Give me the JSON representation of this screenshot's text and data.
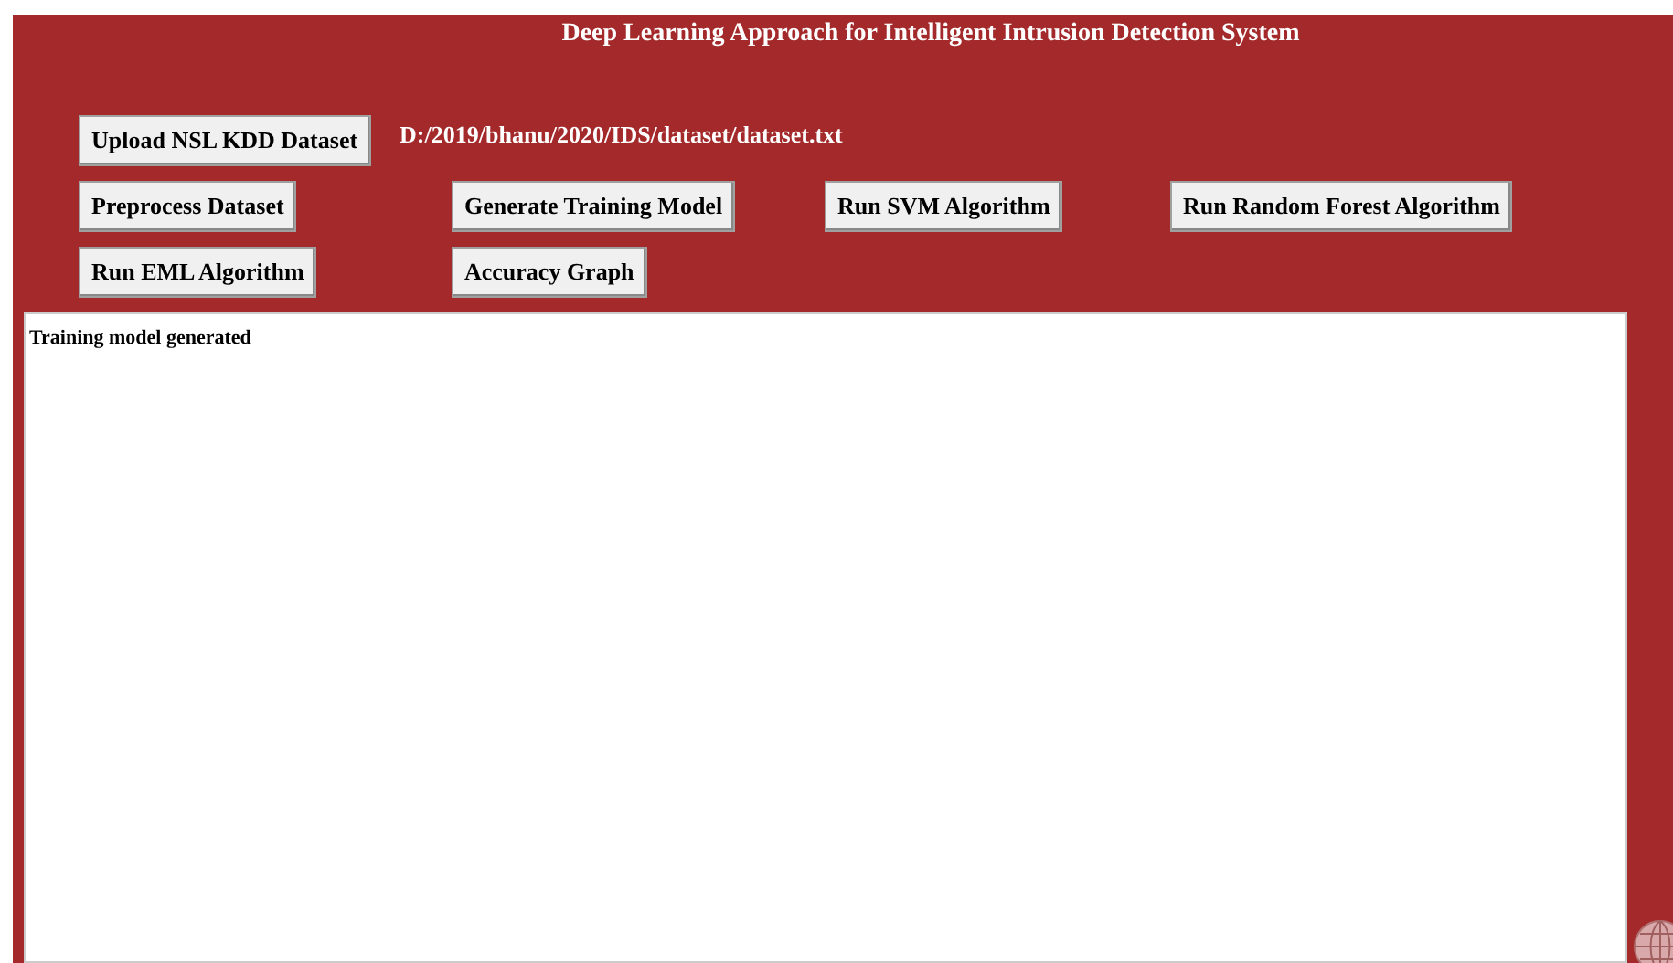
{
  "title": "Deep Learning Approach for Intelligent Intrusion Detection System",
  "upload_button": "Upload NSL KDD Dataset",
  "dataset_path": "D:/2019/bhanu/2020/IDS/dataset/dataset.txt",
  "button_rows": [
    [
      "Preprocess Dataset",
      "Generate Training Model",
      "Run SVM Algorithm",
      "Run Random Forest Algorithm"
    ],
    [
      "Run EML Algorithm",
      "Accuracy Graph"
    ]
  ],
  "output_text": "Training model generated"
}
